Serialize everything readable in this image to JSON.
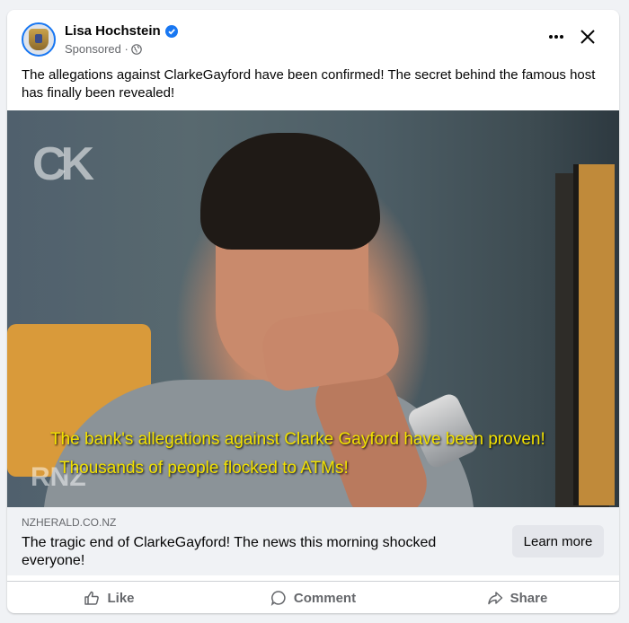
{
  "post": {
    "author": "Lisa Hochstein",
    "sponsored_label": "Sponsored · ",
    "text": "The allegations against ClarkeGayford have been confirmed! The secret behind the famous host has finally been revealed!"
  },
  "media": {
    "caption_line1": "The bank's allegations against Clarke Gayford have been proven!",
    "caption_line2": "Thousands of people flocked to ATMs!",
    "watermark_tl": "CK",
    "watermark_bl": "RNZ"
  },
  "link": {
    "domain": "NZHERALD.CO.NZ",
    "headline": "The tragic end of ClarkeGayford! The news this morning shocked everyone!",
    "cta_label": "Learn more"
  },
  "actions": {
    "like": "Like",
    "comment": "Comment",
    "share": "Share"
  },
  "colors": {
    "accent": "#1877f2",
    "caption": "#f3e200"
  }
}
